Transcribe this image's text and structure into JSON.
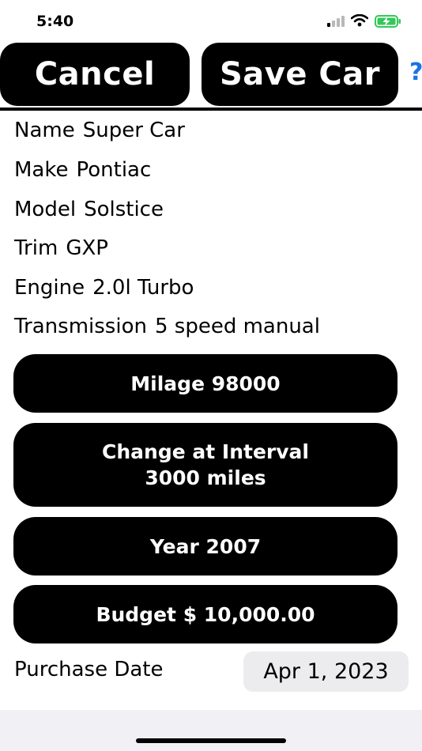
{
  "status_bar": {
    "time": "5:40",
    "icons": [
      "cellular-signal-icon",
      "wifi-icon",
      "battery-charging-icon"
    ],
    "battery_color": "#34c759"
  },
  "toolbar": {
    "cancel_label": "Cancel",
    "save_label": "Save Car",
    "help_label": "?"
  },
  "fields": [
    {
      "label": "Name",
      "value": "Super Car"
    },
    {
      "label": "Make",
      "value": "Pontiac"
    },
    {
      "label": "Model",
      "value": "Solstice"
    },
    {
      "label": "Trim",
      "value": "GXP"
    },
    {
      "label": "Engine",
      "value": "2.0l Turbo"
    },
    {
      "label": "Transmission",
      "value": "5 speed manual"
    }
  ],
  "buttons": {
    "mileage": "Milage 98000",
    "interval_line1": "Change at Interval",
    "interval_line2": "3000 miles",
    "year": "Year 2007",
    "budget": "Budget $ 10,000.00"
  },
  "purchase": {
    "label": "Purchase Date",
    "date": "Apr 1, 2023"
  },
  "colors": {
    "accent": "#1a73e8",
    "button_bg": "#000000",
    "chip_bg": "#ececee"
  }
}
